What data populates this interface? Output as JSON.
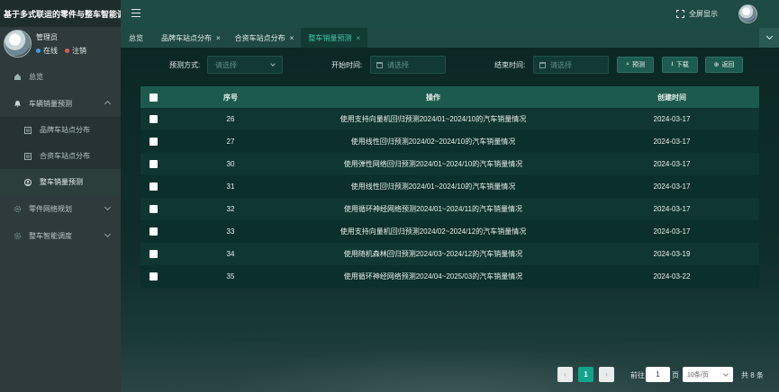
{
  "app": {
    "title": "基于多式联运的零件与整车智能调"
  },
  "user": {
    "name": "管理员",
    "status_online": "在线",
    "status_logout": "注销"
  },
  "sidebar": {
    "items": [
      {
        "label": "总览",
        "icon": "home-icon"
      },
      {
        "label": "车辆销量预测",
        "icon": "bell-icon"
      },
      {
        "label": "品牌车站点分布",
        "icon": "list-icon"
      },
      {
        "label": "合资车站点分布",
        "icon": "list-icon"
      },
      {
        "label": "整车销量预测",
        "icon": "user-icon"
      },
      {
        "label": "零件网络规划",
        "icon": "gear-icon"
      },
      {
        "label": "整车智能调度",
        "icon": "gear-icon"
      }
    ]
  },
  "header": {
    "fullscreen_label": "全屏显示"
  },
  "tabs": [
    {
      "label": "总览"
    },
    {
      "label": "品牌车站点分布",
      "close": "×"
    },
    {
      "label": "合资车站点分布",
      "close": "×"
    },
    {
      "label": "整车销量预测",
      "close": "×"
    }
  ],
  "filters": {
    "method_label": "预测方式:",
    "method_placeholder": "请选择",
    "start_label": "开始时间:",
    "start_placeholder": "请选择",
    "end_label": "结束时间:",
    "end_placeholder": "请选择",
    "predict_button": "预测",
    "download_button": "下载",
    "back_button": "返回"
  },
  "table": {
    "headers": [
      "序号",
      "操作",
      "创建时间"
    ],
    "rows": [
      {
        "no": "26",
        "op": "使用支持向量机回归预测2024/01~2024/10的汽车销量情况",
        "date": "2024-03-17"
      },
      {
        "no": "27",
        "op": "使用线性回归预测2024/02~2024/10的汽车销量情况",
        "date": "2024-03-17"
      },
      {
        "no": "30",
        "op": "使用弹性网络回归预测2024/01~2024/10的汽车销量情况",
        "date": "2024-03-17"
      },
      {
        "no": "31",
        "op": "使用线性回归预测2024/01~2024/10的汽车销量情况",
        "date": "2024-03-17"
      },
      {
        "no": "32",
        "op": "使用循环神经网络预测2024/01~2024/11的汽车销量情况",
        "date": "2024-03-17"
      },
      {
        "no": "33",
        "op": "使用支持向量机回归预测2024/02~2024/12的汽车销量情况",
        "date": "2024-03-17"
      },
      {
        "no": "34",
        "op": "使用随机森林回归预测2024/03~2024/12的汽车销量情况",
        "date": "2024-03-19"
      },
      {
        "no": "35",
        "op": "使用循环神经网络预测2024/04~2025/03的汽车销量情况",
        "date": "2024-03-22"
      }
    ]
  },
  "pagination": {
    "prev": "‹",
    "current": "1",
    "next": "›",
    "goto_label": "前往",
    "goto_value": "1",
    "page_suffix": "页",
    "page_size": "10条/页",
    "total": "共 8 条"
  }
}
